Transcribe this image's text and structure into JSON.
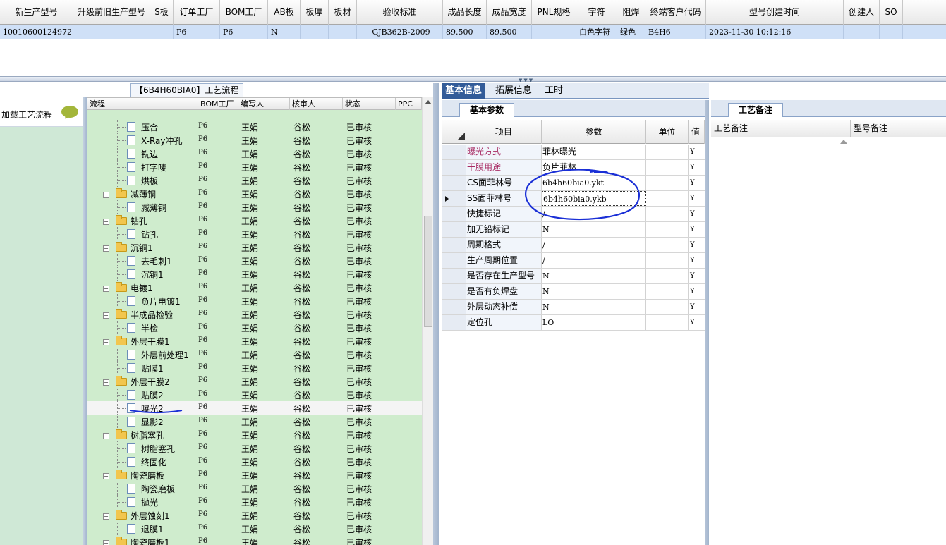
{
  "top_grid": {
    "columns": [
      "新生产型号",
      "升级前旧生产型号",
      "S板",
      "订单工厂",
      "BOM工厂",
      "AB板",
      "板厚",
      "板材",
      "验收标准",
      "成品长度",
      "成品宽度",
      "PNL规格",
      "字符",
      "阻焊",
      "终端客户代码",
      "型号创建时间",
      "创建人",
      "SO"
    ],
    "row": {
      "new_model": "10010600124972",
      "order_factory": "P6",
      "bom_factory": "P6",
      "ab_board": "N",
      "standard": "GJB362B-2009",
      "length": "89.500",
      "width": "89.500",
      "char": "白色字符",
      "solder": "绿色",
      "customer_code": "B4H6",
      "created": "2023-11-30 10:12:16"
    }
  },
  "sidebar": {
    "item_label": "加载工艺流程"
  },
  "tree": {
    "title": "【6B4H60BIA0】工艺流程",
    "columns": [
      "流程",
      "BOM工厂",
      "编写人",
      "核审人",
      "状态",
      "PPC"
    ],
    "rows": [
      {
        "name": "压合",
        "level": 2,
        "bom": "P6",
        "writer": "王娟",
        "reviewer": "谷松",
        "status": "已审核"
      },
      {
        "name": "X-Ray冲孔",
        "level": 2,
        "bom": "P6",
        "writer": "王娟",
        "reviewer": "谷松",
        "status": "已审核"
      },
      {
        "name": "铣边",
        "level": 2,
        "bom": "P6",
        "writer": "王娟",
        "reviewer": "谷松",
        "status": "已审核"
      },
      {
        "name": "打字唛",
        "level": 2,
        "bom": "P6",
        "writer": "王娟",
        "reviewer": "谷松",
        "status": "已审核"
      },
      {
        "name": "烘板",
        "level": 2,
        "bom": "P6",
        "writer": "王娟",
        "reviewer": "谷松",
        "status": "已审核"
      },
      {
        "name": "减薄铜",
        "level": 1,
        "bom": "P6",
        "writer": "王娟",
        "reviewer": "谷松",
        "status": "已审核"
      },
      {
        "name": "减薄铜",
        "level": 2,
        "bom": "P6",
        "writer": "王娟",
        "reviewer": "谷松",
        "status": "已审核"
      },
      {
        "name": "钻孔",
        "level": 1,
        "bom": "P6",
        "writer": "王娟",
        "reviewer": "谷松",
        "status": "已审核"
      },
      {
        "name": "钻孔",
        "level": 2,
        "bom": "P6",
        "writer": "王娟",
        "reviewer": "谷松",
        "status": "已审核"
      },
      {
        "name": "沉铜1",
        "level": 1,
        "bom": "P6",
        "writer": "王娟",
        "reviewer": "谷松",
        "status": "已审核"
      },
      {
        "name": "去毛刺1",
        "level": 2,
        "bom": "P6",
        "writer": "王娟",
        "reviewer": "谷松",
        "status": "已审核"
      },
      {
        "name": "沉铜1",
        "level": 2,
        "bom": "P6",
        "writer": "王娟",
        "reviewer": "谷松",
        "status": "已审核"
      },
      {
        "name": "电镀1",
        "level": 1,
        "bom": "P6",
        "writer": "王娟",
        "reviewer": "谷松",
        "status": "已审核"
      },
      {
        "name": "负片电镀1",
        "level": 2,
        "bom": "P6",
        "writer": "王娟",
        "reviewer": "谷松",
        "status": "已审核"
      },
      {
        "name": "半成品检验",
        "level": 1,
        "bom": "P6",
        "writer": "王娟",
        "reviewer": "谷松",
        "status": "已审核"
      },
      {
        "name": "半检",
        "level": 2,
        "bom": "P6",
        "writer": "王娟",
        "reviewer": "谷松",
        "status": "已审核"
      },
      {
        "name": "外层干膜1",
        "level": 1,
        "bom": "P6",
        "writer": "王娟",
        "reviewer": "谷松",
        "status": "已审核"
      },
      {
        "name": "外层前处理1",
        "level": 2,
        "bom": "P6",
        "writer": "王娟",
        "reviewer": "谷松",
        "status": "已审核"
      },
      {
        "name": "贴膜1",
        "level": 2,
        "bom": "P6",
        "writer": "王娟",
        "reviewer": "谷松",
        "status": "已审核"
      },
      {
        "name": "外层干膜2",
        "level": 1,
        "bom": "P6",
        "writer": "王娟",
        "reviewer": "谷松",
        "status": "已审核"
      },
      {
        "name": "贴膜2",
        "level": 2,
        "bom": "P6",
        "writer": "王娟",
        "reviewer": "谷松",
        "status": "已审核"
      },
      {
        "name": "曝光2",
        "level": 2,
        "bom": "P6",
        "writer": "王娟",
        "reviewer": "谷松",
        "status": "已审核",
        "selected": true
      },
      {
        "name": "显影2",
        "level": 2,
        "bom": "P6",
        "writer": "王娟",
        "reviewer": "谷松",
        "status": "已审核"
      },
      {
        "name": "树脂塞孔",
        "level": 1,
        "bom": "P6",
        "writer": "王娟",
        "reviewer": "谷松",
        "status": "已审核"
      },
      {
        "name": "树脂塞孔",
        "level": 2,
        "bom": "P6",
        "writer": "王娟",
        "reviewer": "谷松",
        "status": "已审核"
      },
      {
        "name": "终固化",
        "level": 2,
        "bom": "P6",
        "writer": "王娟",
        "reviewer": "谷松",
        "status": "已审核"
      },
      {
        "name": "陶瓷磨板",
        "level": 1,
        "bom": "P6",
        "writer": "王娟",
        "reviewer": "谷松",
        "status": "已审核"
      },
      {
        "name": "陶瓷磨板",
        "level": 2,
        "bom": "P6",
        "writer": "王娟",
        "reviewer": "谷松",
        "status": "已审核"
      },
      {
        "name": "抛光",
        "level": 2,
        "bom": "P6",
        "writer": "王娟",
        "reviewer": "谷松",
        "status": "已审核"
      },
      {
        "name": "外层蚀刻1",
        "level": 1,
        "bom": "P6",
        "writer": "王娟",
        "reviewer": "谷松",
        "status": "已审核"
      },
      {
        "name": "退膜1",
        "level": 2,
        "bom": "P6",
        "writer": "王娟",
        "reviewer": "谷松",
        "status": "已审核"
      },
      {
        "name": "陶瓷磨板1",
        "level": 1,
        "bom": "P6",
        "writer": "王娟",
        "reviewer": "谷松",
        "status": "已审核"
      }
    ]
  },
  "info_panel": {
    "tabs": [
      "基本信息",
      "拓展信息",
      "工时"
    ],
    "subtab": "基本参数",
    "columns": [
      "项目",
      "参数",
      "单位",
      "值"
    ],
    "rows": [
      {
        "item": "曝光方式",
        "param": "菲林曝光",
        "flag": "Y",
        "highlight": true
      },
      {
        "item": "干膜用途",
        "param": "负片菲林",
        "flag": "Y",
        "highlight": true
      },
      {
        "item": "CS面菲林号",
        "param": "6b4h60bia0.ykt",
        "flag": "Y"
      },
      {
        "item": "SS面菲林号",
        "param": "6b4h60bia0.ykb",
        "flag": "Y",
        "current": true
      },
      {
        "item": "快捷标记",
        "param": "/",
        "flag": "Y"
      },
      {
        "item": "加无铅标记",
        "param": "N",
        "flag": "Y"
      },
      {
        "item": "周期格式",
        "param": "/",
        "flag": "Y"
      },
      {
        "item": "生产周期位置",
        "param": "/",
        "flag": "Y"
      },
      {
        "item": "是否存在生产型号",
        "param": "N",
        "flag": "Y"
      },
      {
        "item": "是否有负焊盘",
        "param": "N",
        "flag": "Y"
      },
      {
        "item": "外层动态补偿",
        "param": "N",
        "flag": "Y"
      },
      {
        "item": "定位孔",
        "param": "LO",
        "flag": "Y"
      }
    ]
  },
  "remark_panel": {
    "tab": "工艺备注",
    "columns": [
      "工艺备注",
      "型号备注"
    ]
  },
  "colors": {
    "accent": "#335c99",
    "tree_bg": "#cfeccd",
    "highlight_text": "#a82b63",
    "annotation": "#1a2fd6"
  }
}
